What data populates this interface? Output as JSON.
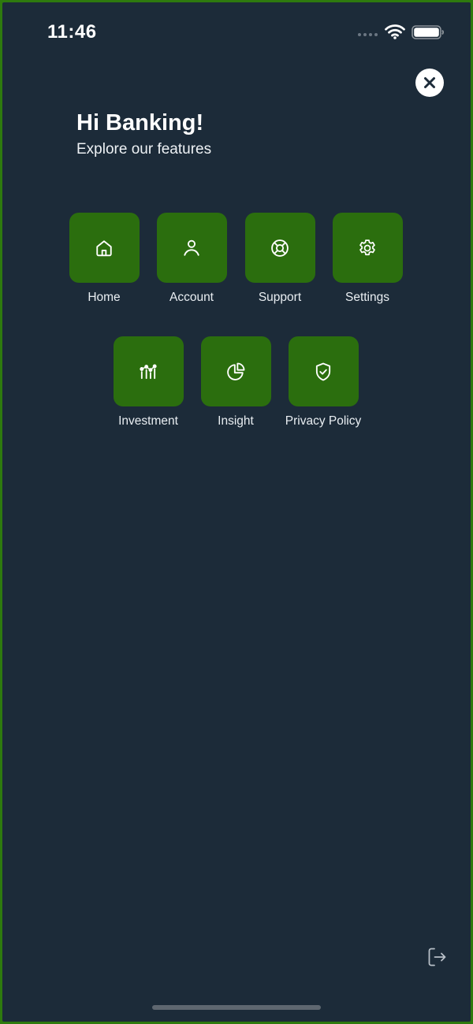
{
  "status_bar": {
    "time": "11:46"
  },
  "header": {
    "greeting": "Hi Banking!",
    "subtitle": "Explore our features"
  },
  "features": [
    {
      "label": "Home",
      "icon": "home-icon"
    },
    {
      "label": "Account",
      "icon": "user-icon"
    },
    {
      "label": "Support",
      "icon": "lifebuoy-icon"
    },
    {
      "label": "Settings",
      "icon": "gear-icon"
    },
    {
      "label": "Investment",
      "icon": "chart-icon"
    },
    {
      "label": "Insight",
      "icon": "pie-chart-icon"
    },
    {
      "label": "Privacy Policy",
      "icon": "shield-check-icon"
    }
  ],
  "colors": {
    "background": "#1c2b39",
    "tile": "#2b6e0e",
    "frame": "#2e7a0e"
  }
}
